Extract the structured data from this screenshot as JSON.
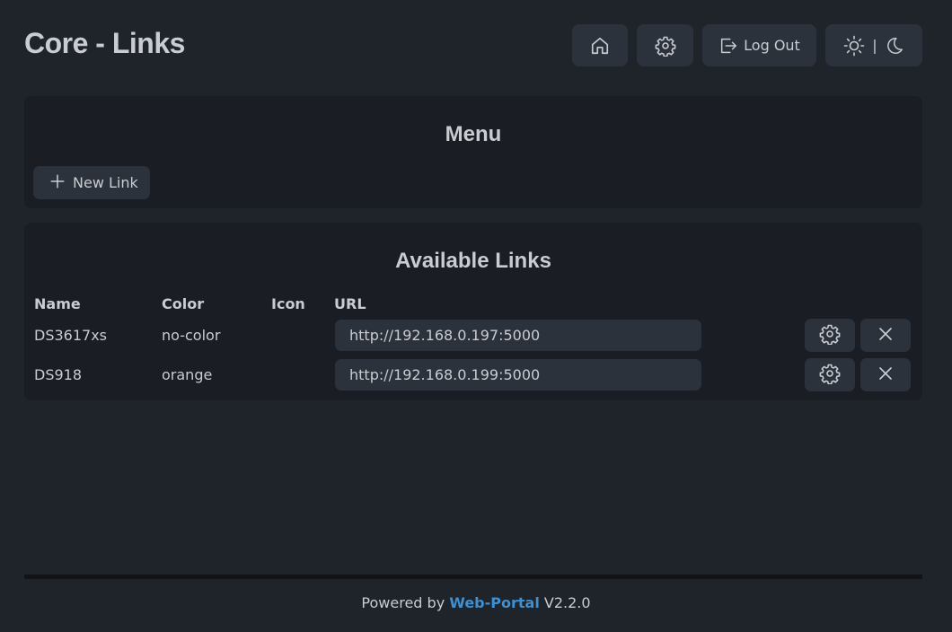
{
  "header": {
    "title": "Core - Links",
    "logout_label": "Log Out",
    "theme_separator": "|"
  },
  "menu": {
    "title": "Menu",
    "new_link_label": "New Link"
  },
  "links": {
    "title": "Available Links",
    "columns": [
      "Name",
      "Color",
      "Icon",
      "URL"
    ],
    "rows": [
      {
        "name": "DS3617xs",
        "color": "no-color",
        "icon": "",
        "url": "http://192.168.0.197:5000"
      },
      {
        "name": "DS918",
        "color": "orange",
        "icon": "",
        "url": "http://192.168.0.199:5000"
      }
    ]
  },
  "footer": {
    "prefix": "Powered by",
    "link": "Web-Portal",
    "version": "V2.2.0"
  },
  "colors": {
    "background": "#1f232a",
    "card": "#1a1d23",
    "button": "#2c323b",
    "text": "#c9ccd1",
    "accent_link": "#3f8fd1"
  }
}
